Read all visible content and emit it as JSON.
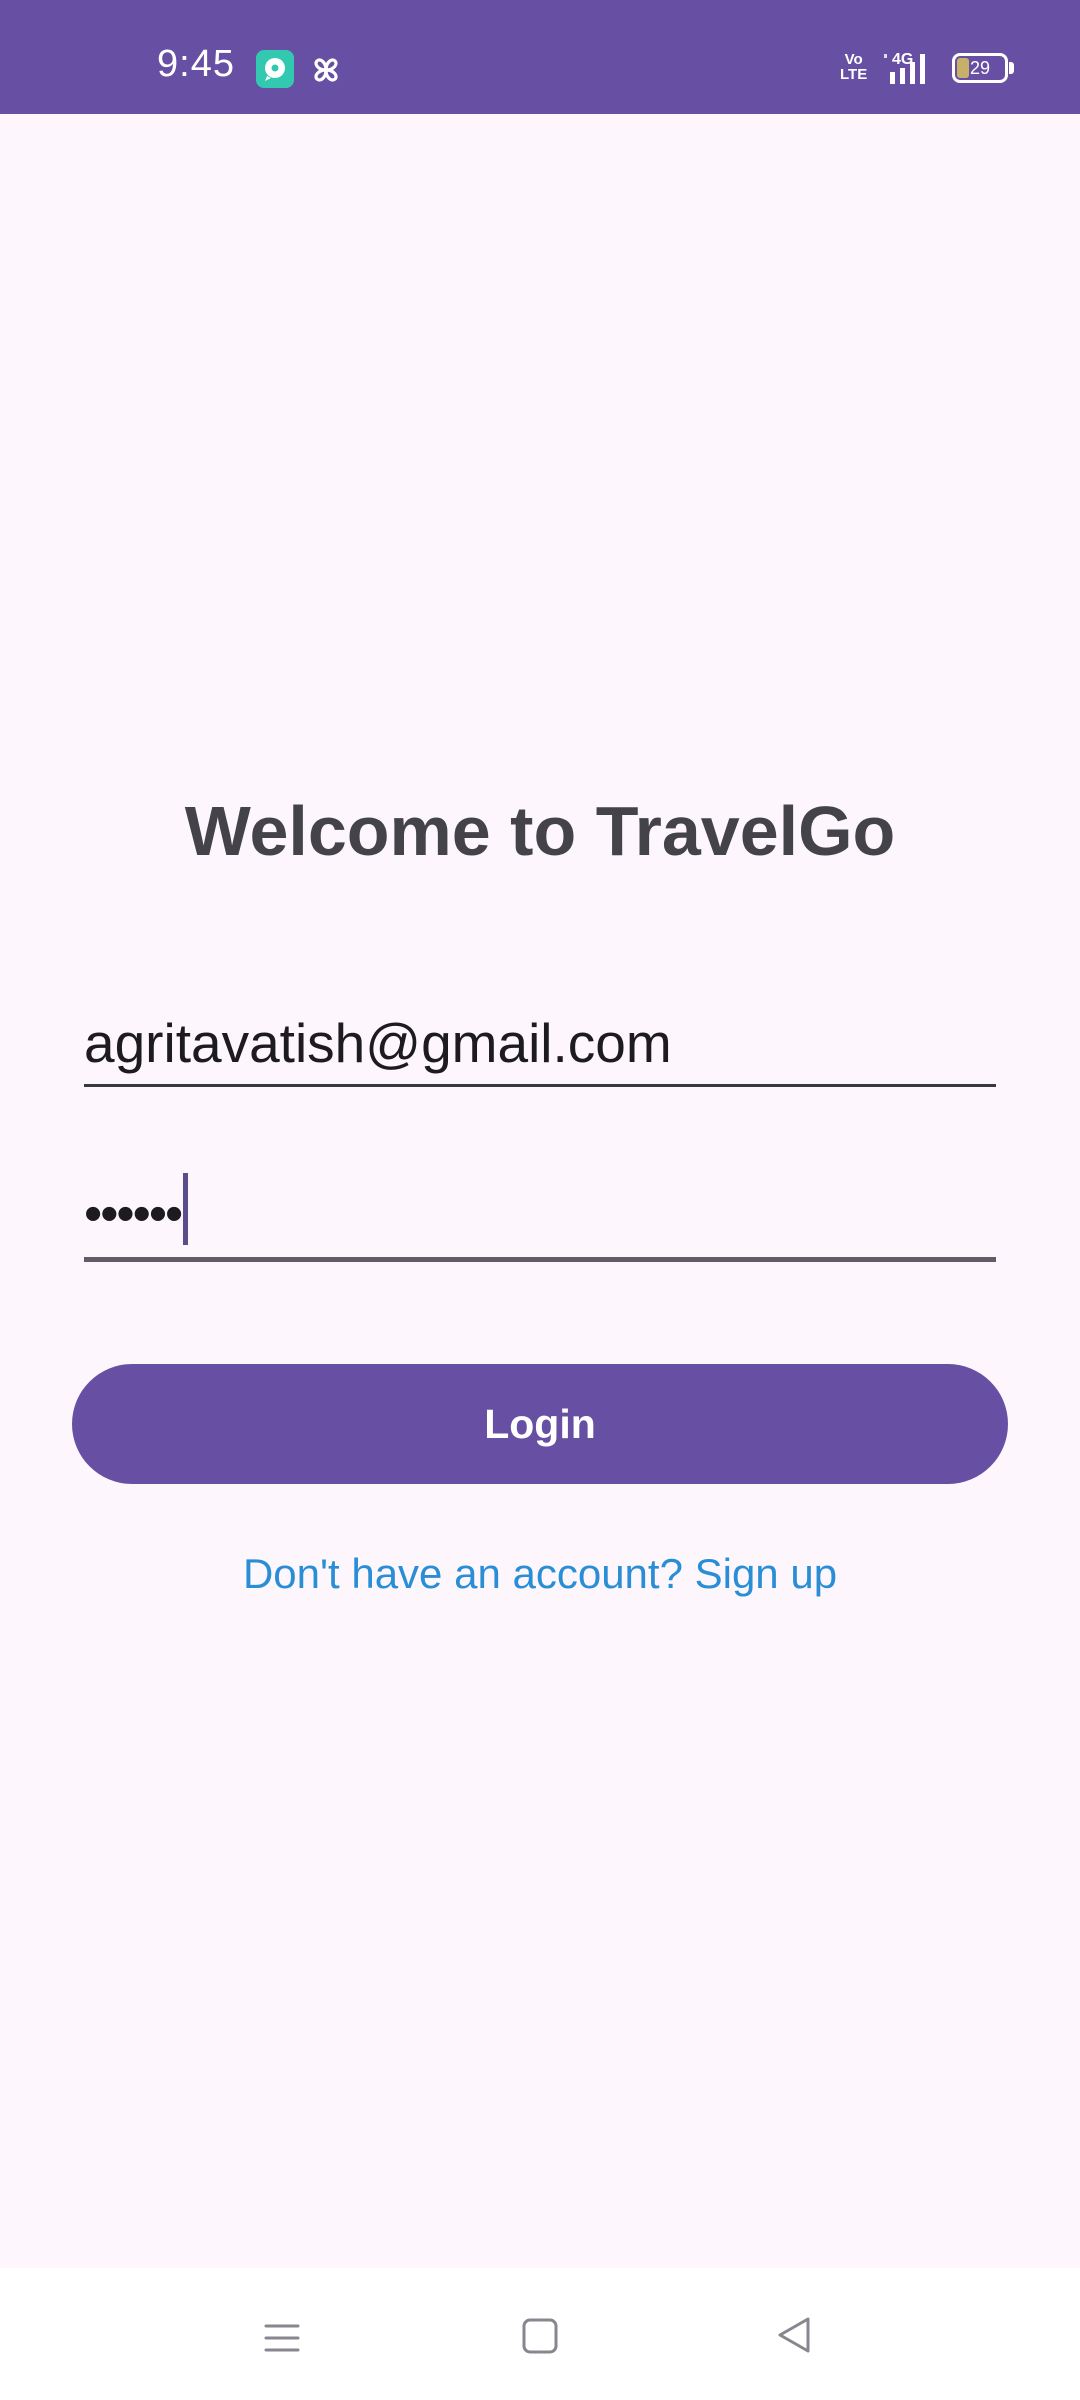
{
  "status_bar": {
    "time": "9:45",
    "volte_line1": "Vo",
    "volte_line2": "LTE",
    "network": "4G",
    "battery_level": "29",
    "background_color": "#6750a4"
  },
  "login_screen": {
    "title": "Welcome to TravelGo",
    "email_value": "agritavatish@gmail.com",
    "password_mask": "••••••",
    "login_button_label": "Login",
    "signup_link_label": "Don't have an account? Sign up",
    "accent_color": "#6750a4",
    "link_color": "#2a8ed6"
  },
  "navigation_bar": {
    "icons": [
      "menu-icon",
      "home-icon",
      "back-icon"
    ]
  }
}
